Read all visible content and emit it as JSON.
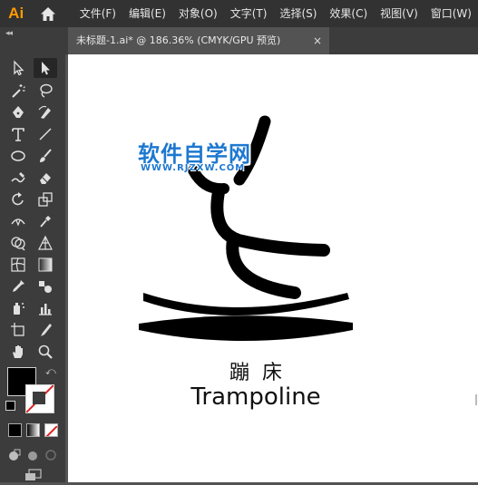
{
  "app": {
    "logo": "Ai"
  },
  "menu": [
    "文件(F)",
    "编辑(E)",
    "对象(O)",
    "文字(T)",
    "选择(S)",
    "效果(C)",
    "视图(V)",
    "窗口(W)"
  ],
  "tab": {
    "title": "未标题-1.ai* @ 186.36% (CMYK/GPU 预览)",
    "close": "×"
  },
  "panel": {
    "collapse": "◂◂"
  },
  "artwork": {
    "caption_cn": "蹦床",
    "caption_en": "Trampoline",
    "watermark_cn": "软件自学网",
    "watermark_url": "WWW.RJZXW.COM"
  },
  "colors": {
    "menubar": "#323232",
    "panel": "#3c3c3c",
    "canvas_bg": "#535353",
    "artboard": "#ffffff",
    "accent_logo": "#ff9a00",
    "watermark": "#1e78d0",
    "fill_swatch": "#000000",
    "stroke_swatch": "none"
  },
  "tools": [
    "selection-tool",
    "direct-selection-tool",
    "magic-wand-tool",
    "lasso-tool",
    "pen-tool",
    "curvature-tool",
    "type-tool",
    "line-segment-tool",
    "ellipse-tool",
    "paintbrush-tool",
    "shaper-tool",
    "eraser-tool",
    "rotate-tool",
    "scale-tool",
    "width-tool",
    "puppet-warp-tool",
    "shape-builder-tool",
    "perspective-grid-tool",
    "mesh-tool",
    "gradient-tool",
    "eyedropper-tool",
    "blend-tool",
    "symbol-sprayer-tool",
    "column-graph-tool",
    "artboard-tool",
    "slice-tool",
    "hand-tool",
    "zoom-tool"
  ]
}
